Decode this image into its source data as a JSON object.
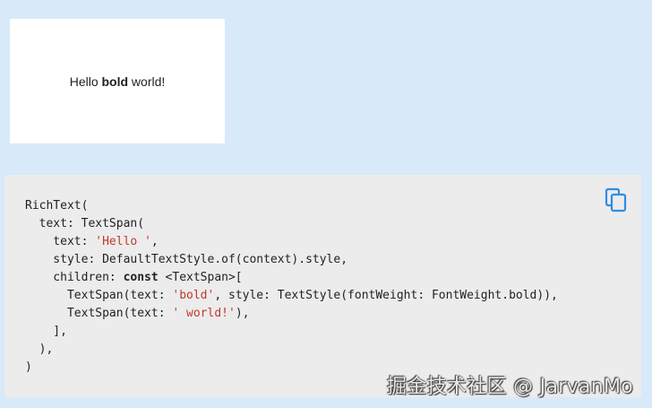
{
  "preview": {
    "text_before": "Hello ",
    "text_bold": "bold",
    "text_after": " world!"
  },
  "code": {
    "lines": [
      [
        {
          "t": "RichText("
        }
      ],
      [
        {
          "t": "  text: TextSpan("
        }
      ],
      [
        {
          "t": "    text: "
        },
        {
          "t": "'Hello '",
          "c": "str"
        },
        {
          "t": ","
        }
      ],
      [
        {
          "t": "    style: DefaultTextStyle.of(context).style,"
        }
      ],
      [
        {
          "t": "    children: "
        },
        {
          "t": "const",
          "c": "kw"
        },
        {
          "t": " <TextSpan>["
        }
      ],
      [
        {
          "t": "      TextSpan(text: "
        },
        {
          "t": "'bold'",
          "c": "str"
        },
        {
          "t": ", style: TextStyle(fontWeight: FontWeight.bold)),"
        }
      ],
      [
        {
          "t": "      TextSpan(text: "
        },
        {
          "t": "' world!'",
          "c": "str"
        },
        {
          "t": "),"
        }
      ],
      [
        {
          "t": "    ],"
        }
      ],
      [
        {
          "t": "  ),"
        }
      ],
      [
        {
          "t": ")"
        }
      ]
    ]
  },
  "copy_button": {
    "icon": "copy-icon"
  },
  "watermark": {
    "text": "掘金技术社区 @ JarvanMo"
  }
}
